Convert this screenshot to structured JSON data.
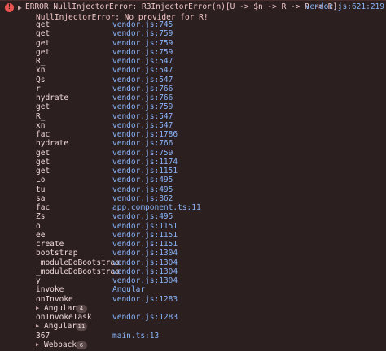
{
  "error": {
    "line1": "ERROR NullInjectorError: R3InjectorError(n)[U -> $n -> R -> R -> R]:",
    "line2": "NullInjectorError: No provider for R!",
    "source": "vendor.js:621:219"
  },
  "frames": [
    {
      "fn": "get",
      "loc": "vendor.js:745"
    },
    {
      "fn": "get",
      "loc": "vendor.js:759"
    },
    {
      "fn": "get",
      "loc": "vendor.js:759"
    },
    {
      "fn": "get",
      "loc": "vendor.js:759"
    },
    {
      "fn": "R_",
      "loc": "vendor.js:547"
    },
    {
      "fn": "xn",
      "loc": "vendor.js:547"
    },
    {
      "fn": "Qs",
      "loc": "vendor.js:547"
    },
    {
      "fn": "r",
      "loc": "vendor.js:766"
    },
    {
      "fn": "hydrate",
      "loc": "vendor.js:766"
    },
    {
      "fn": "get",
      "loc": "vendor.js:759"
    },
    {
      "fn": "R_",
      "loc": "vendor.js:547"
    },
    {
      "fn": "xn",
      "loc": "vendor.js:547"
    },
    {
      "fn": "fac",
      "loc": "vendor.js:1786"
    },
    {
      "fn": "hydrate",
      "loc": "vendor.js:766"
    },
    {
      "fn": "get",
      "loc": "vendor.js:759"
    },
    {
      "fn": "get",
      "loc": "vendor.js:1174"
    },
    {
      "fn": "get",
      "loc": "vendor.js:1151"
    },
    {
      "fn": "Lo",
      "loc": "vendor.js:495"
    },
    {
      "fn": "tu",
      "loc": "vendor.js:495"
    },
    {
      "fn": "sa",
      "loc": "vendor.js:862"
    },
    {
      "fn": "fac",
      "loc": "app.component.ts:11"
    },
    {
      "fn": "Zs",
      "loc": "vendor.js:495"
    },
    {
      "fn": "o",
      "loc": "vendor.js:1151"
    },
    {
      "fn": "ee",
      "loc": "vendor.js:1151"
    },
    {
      "fn": "create",
      "loc": "vendor.js:1151"
    },
    {
      "fn": "bootstrap",
      "loc": "vendor.js:1304"
    },
    {
      "fn": "_moduleDoBootstrap",
      "loc": "vendor.js:1304"
    },
    {
      "fn": "_moduleDoBootstrap",
      "loc": "vendor.js:1304"
    },
    {
      "fn": "y",
      "loc": "vendor.js:1304"
    },
    {
      "fn": "invoke",
      "loc": "Angular"
    },
    {
      "fn": "onInvoke",
      "loc": "vendor.js:1283"
    }
  ],
  "group1": {
    "name": "Angular",
    "count": "4"
  },
  "frame_after_group1": {
    "fn": "onInvokeTask",
    "loc": "vendor.js:1283"
  },
  "group2": {
    "name": "Angular",
    "count": "11"
  },
  "frame_after_group2": {
    "fn": "367",
    "loc": "main.ts:13"
  },
  "group3": {
    "name": "Webpack",
    "count": "6"
  },
  "icons": {
    "error": "error-circle-icon",
    "expand": "triangle-right-icon"
  },
  "colors": {
    "background": "#2b1f20",
    "error_text": "#f2c6c6",
    "link": "#8ab4f8"
  }
}
